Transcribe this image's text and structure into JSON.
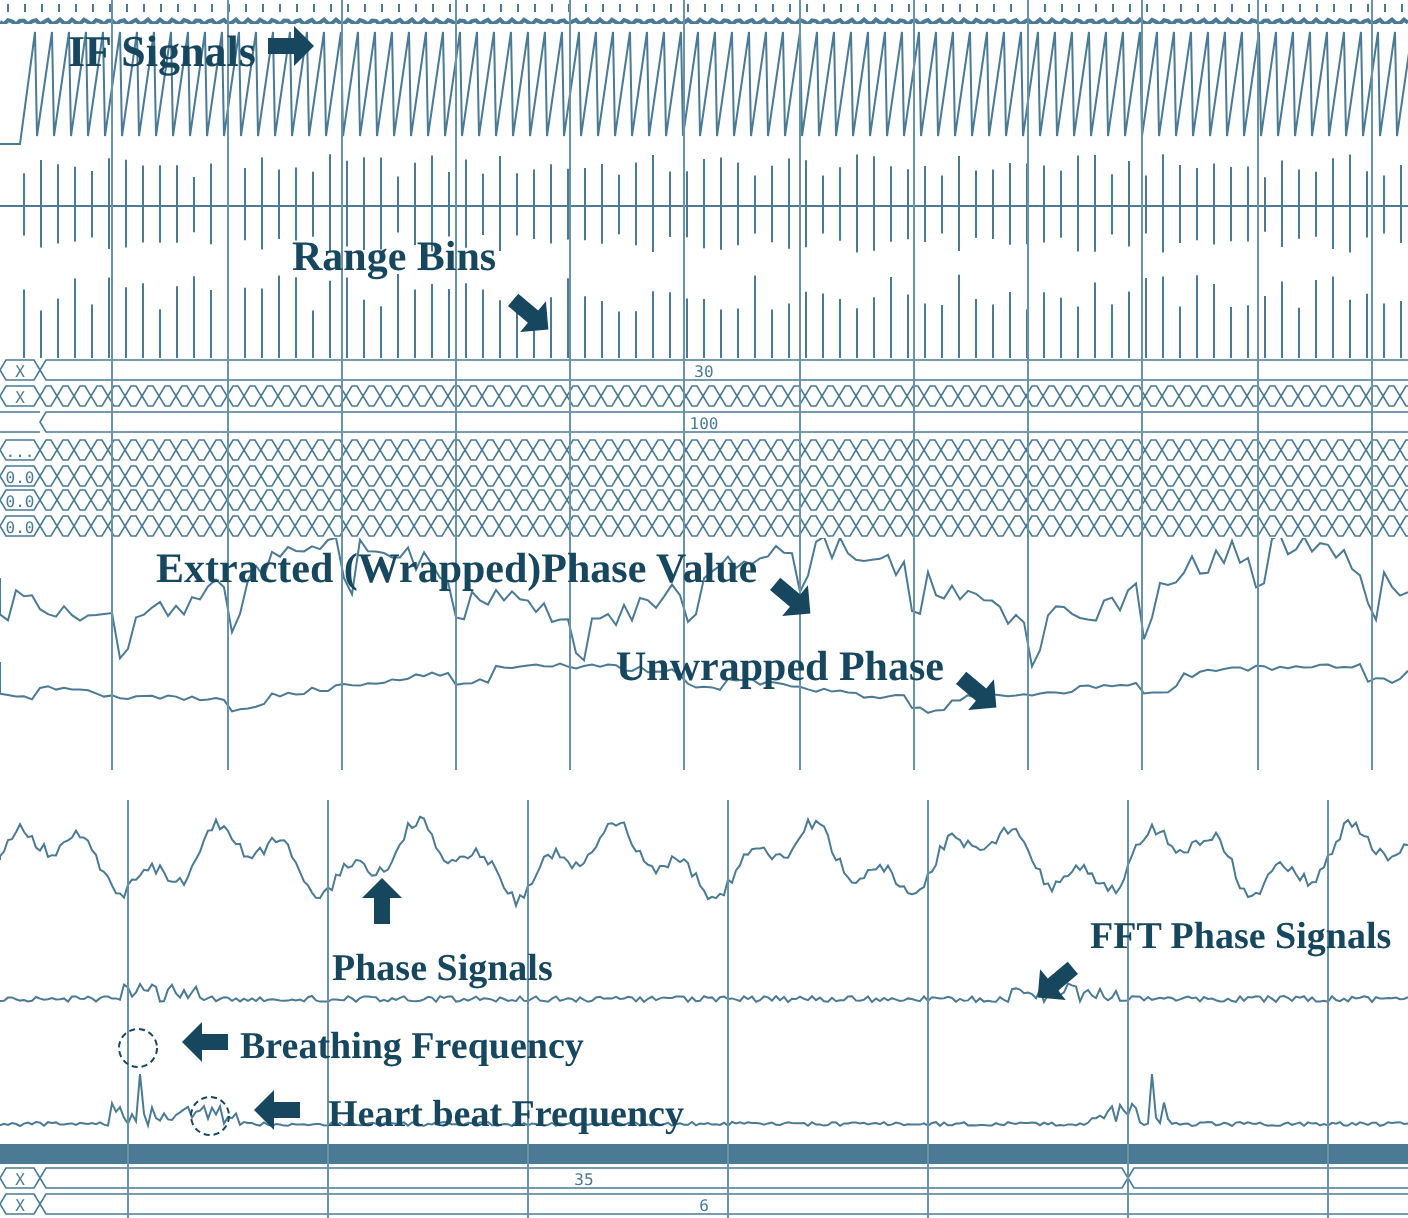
{
  "top_panel": {
    "annotations": [
      {
        "text": "IF Signals",
        "circled": false
      },
      {
        "text": "Range Bins",
        "circled": false
      },
      {
        "text": "Extracted (Wrapped)Phase Value",
        "circled": false
      },
      {
        "text": "Unwrapped Phase",
        "circled": false
      }
    ],
    "bus_rows": [
      {
        "label": "X",
        "value": "30",
        "kind": "solid"
      },
      {
        "label": "X",
        "kind": "toggling"
      },
      {
        "value": "100",
        "kind": "solid"
      },
      {
        "label": "...",
        "kind": "toggling"
      },
      {
        "label": "0.0",
        "kind": "toggling"
      },
      {
        "label": "0.0",
        "kind": "toggling"
      },
      {
        "label": "0.0",
        "kind": "toggling"
      }
    ]
  },
  "bottom_panel": {
    "annotations": [
      {
        "text": "Phase Signals",
        "circled": false
      },
      {
        "text": "FFT Phase Signals",
        "circled": false
      },
      {
        "text": "Breathing Frequency",
        "circled": true
      },
      {
        "text": "Heart beat Frequency",
        "circled": true
      }
    ],
    "bus_rows": [
      {
        "label": "X",
        "value": "35",
        "kind": "solid"
      },
      {
        "label": "X",
        "value": "6",
        "kind": "solid"
      }
    ]
  }
}
